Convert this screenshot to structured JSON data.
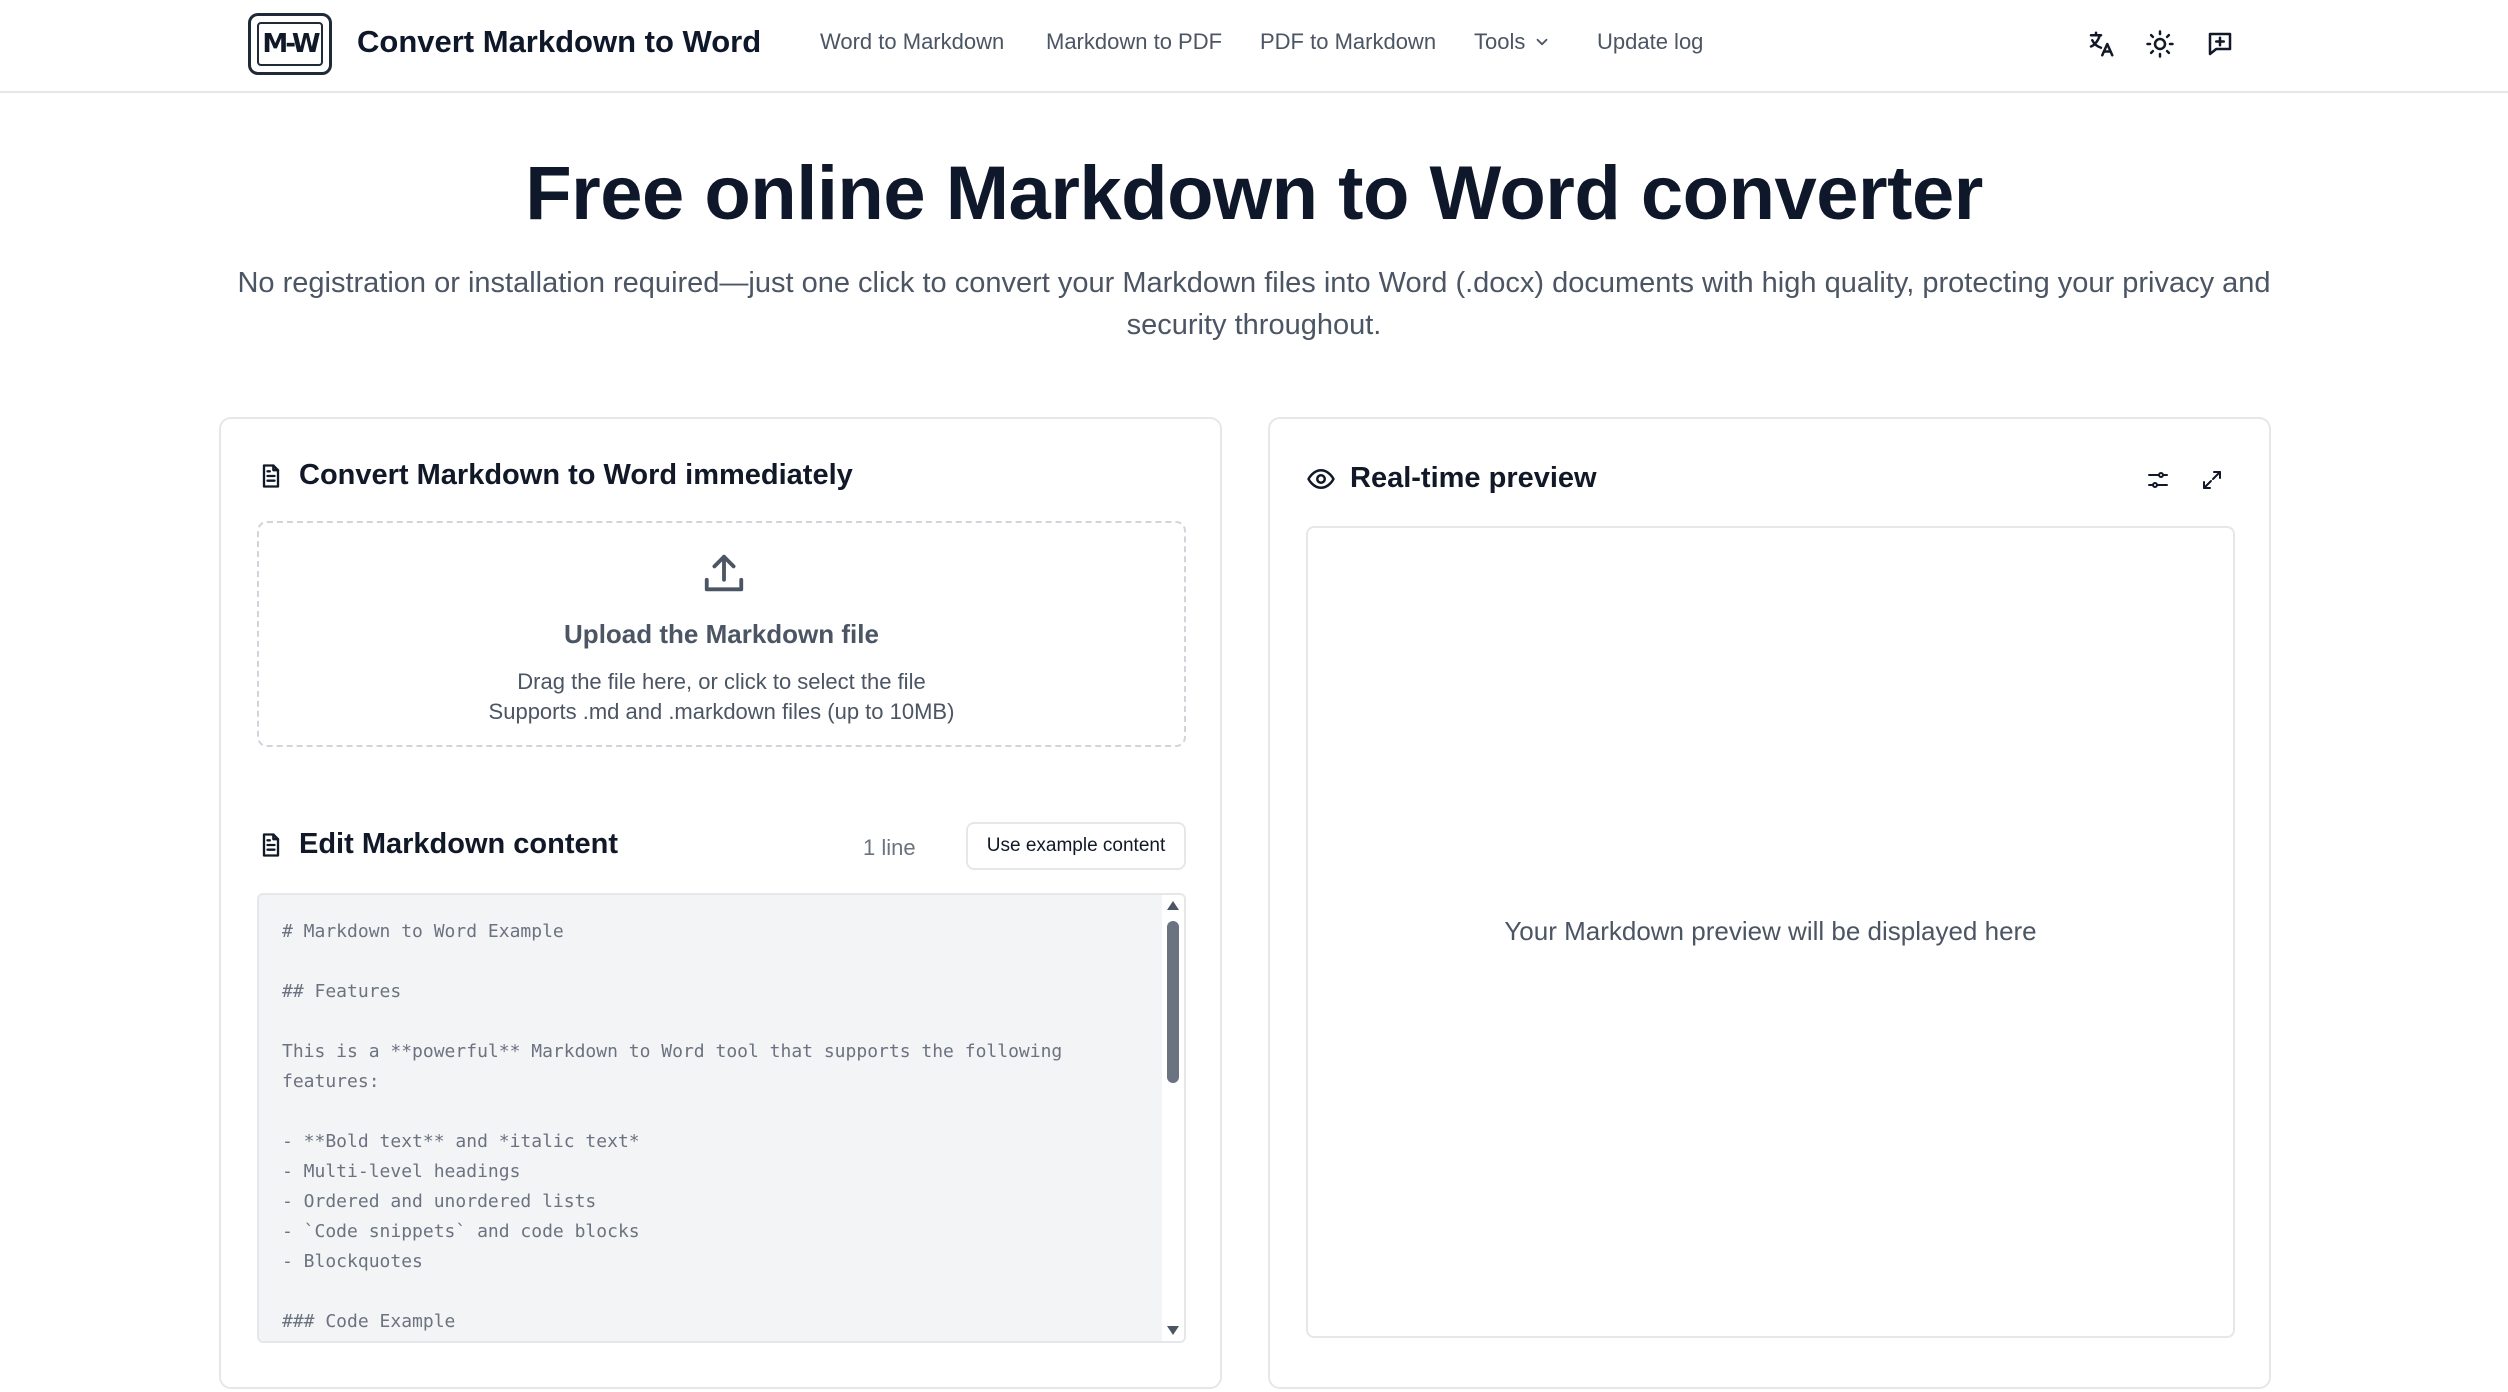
{
  "header": {
    "logo_text": "M-W",
    "brand": "Convert Markdown to Word",
    "nav": [
      {
        "label": "Word to Markdown"
      },
      {
        "label": "Markdown to PDF"
      },
      {
        "label": "PDF to Markdown"
      },
      {
        "label": "Tools"
      },
      {
        "label": "Update log"
      }
    ],
    "icons": [
      "translate-icon",
      "sun-icon",
      "feedback-icon"
    ]
  },
  "hero": {
    "title": "Free online Markdown to Word converter",
    "subtitle": "No registration or installation required—just one click to convert your Markdown files into Word (.docx) documents with high quality, protecting your privacy and security throughout."
  },
  "converter": {
    "title": "Convert Markdown to Word immediately",
    "upload": {
      "title": "Upload the Markdown file",
      "hint": "Drag the file here, or click to select the file",
      "support": "Supports .md and .markdown files (up to 10MB)"
    },
    "editor": {
      "title": "Edit Markdown content",
      "line_count": "1 line",
      "example_button": "Use example content",
      "content": "# Markdown to Word Example\n\n## Features\n\nThis is a **powerful** Markdown to Word tool that supports the following features:\n\n- **Bold text** and *italic text*\n- Multi-level headings\n- Ordered and unordered lists\n- `Code snippets` and code blocks\n- Blockquotes\n\n### Code Example"
    }
  },
  "preview": {
    "title": "Real-time preview",
    "placeholder": "Your Markdown preview will be displayed here",
    "icons": [
      "settings-sliders-icon",
      "expand-icon"
    ]
  },
  "colors": {
    "text_primary": "#0f172a",
    "text_muted": "#4b5563",
    "border": "#e5e7eb",
    "editor_bg": "#f3f4f6"
  }
}
